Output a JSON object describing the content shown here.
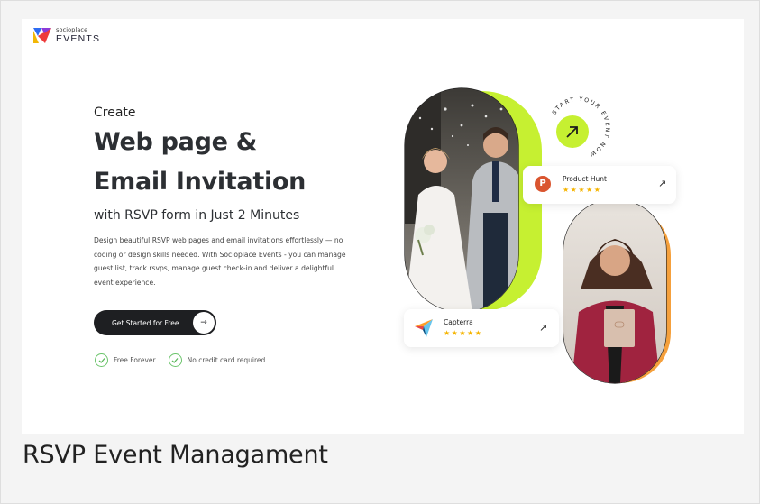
{
  "brand": {
    "small_text": "socioplace",
    "big_text": "EVENTS"
  },
  "hero": {
    "eyebrow": "Create",
    "title_line1": "Web page &",
    "title_line2": "Email Invitation",
    "subhead": "with RSVP form in Just 2 Minutes",
    "description": "Design beautiful RSVP web pages and email invitations effortlessly — no coding or design skills needed. With Socioplace Events - you can manage guest list, track rsvps, manage guest check-in and deliver a delightful event experience."
  },
  "cta": {
    "label": "Get Started for Free",
    "icon": "arrow-right-icon"
  },
  "perks": [
    {
      "label": "Free Forever",
      "icon": "check-circle-icon"
    },
    {
      "label": "No credit card required",
      "icon": "check-circle-icon"
    }
  ],
  "badge": {
    "circular_text": "START YOUR EVENT NOW",
    "icon": "arrow-up-right-icon"
  },
  "ratings": [
    {
      "name": "Product Hunt",
      "stars": "★★★★★",
      "logo_letter": "P",
      "icon": "arrow-up-right-icon"
    },
    {
      "name": "Capterra",
      "stars": "★★★★★",
      "icon": "arrow-up-right-icon"
    }
  ],
  "colors": {
    "accent_green": "#c6f031",
    "accent_orange": "#f5a03c",
    "dark": "#1e1f22",
    "product_hunt": "#da552f",
    "star": "#f5b400"
  },
  "caption": "RSVP Event Managament"
}
